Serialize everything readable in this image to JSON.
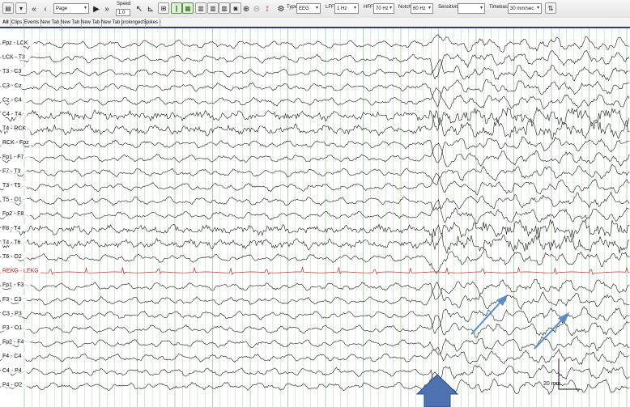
{
  "toolbar": {
    "page_label": "Page",
    "speed_label": "Speed",
    "speed_value": "1.0",
    "type_label": "Type",
    "type_value": "EEG",
    "lff_label": "LFF",
    "lff_value": "1 Hz",
    "hff_label": "HFF",
    "hff_value": "70 Hz",
    "notch_label": "Notch",
    "notch_value": "60 Hz",
    "sensitivity_label": "Sensitivity",
    "sensitivity_value": "",
    "timebase_label": "Timebase",
    "timebase_value": "30 mm/sec"
  },
  "tabs": [
    "All",
    "Clips",
    "Events",
    "New Tab",
    "New Tab",
    "New Tab",
    "New Tab",
    "prolonged",
    "Spikes"
  ],
  "channels": [
    "Fpz - LCK",
    "LCK - T3",
    "T3 - C3",
    "C3 - Cz",
    "Cz - C4",
    "C4 - T4",
    "T4 - RCK",
    "RCK - Fpz",
    "Fp1 - F7",
    "F7 - T3",
    "T3 - T5",
    "T5 - O1",
    "Fp2 - F8",
    "F8 - T4",
    "T4 - T6",
    "T6 - O2",
    "REKG - LEKG",
    "Fp1 - F3",
    "F3 - C3",
    "C3 - P3",
    "P3 - O1",
    "Fp2 - F4",
    "F4 - C4",
    "C4 - P4",
    "P4 - O2"
  ],
  "scale_bar": {
    "label": "20 mm"
  },
  "colors": {
    "trace": "#1a1a1a",
    "ecg": "#b03030",
    "grid": "#7fbf7f",
    "tab_underline": "#2a3a8f",
    "arrow": "#4d7fb8"
  }
}
